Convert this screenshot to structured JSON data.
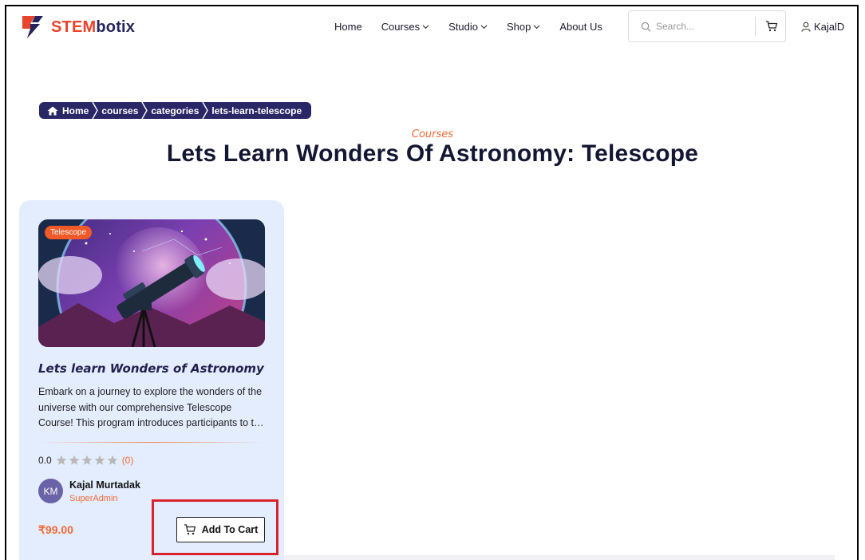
{
  "brand": {
    "name_part1": "STEM",
    "name_part2": "botix",
    "accent_color": "#e8432b",
    "dark_color": "#26245f"
  },
  "nav": {
    "items": [
      {
        "label": "Home",
        "has_dropdown": false
      },
      {
        "label": "Courses",
        "has_dropdown": true
      },
      {
        "label": "Studio",
        "has_dropdown": true
      },
      {
        "label": "Shop",
        "has_dropdown": true
      },
      {
        "label": "About Us",
        "has_dropdown": false
      }
    ]
  },
  "search": {
    "placeholder": "Search...",
    "value": ""
  },
  "user": {
    "name": "KajalD"
  },
  "breadcrumb": [
    "Home",
    "courses",
    "categories",
    "lets-learn-telescope"
  ],
  "page": {
    "eyebrow": "Courses",
    "title": "Lets Learn Wonders Of Astronomy: Telescope"
  },
  "course_card": {
    "tag": "Telescope",
    "title": "Lets learn Wonders of Astronomy",
    "description": "Embark on a journey to explore the wonders of the universe with our comprehensive Telescope Course! This program introduces participants to the fascinating world of astronomy.",
    "rating_value": "0.0",
    "rating_stars": 0,
    "rating_count": "(0)",
    "author_initials": "KM",
    "author_name": "Kajal Murtadak",
    "author_role": "SuperAdmin",
    "price": "₹99.00",
    "cta_label": "Add To Cart"
  },
  "colors": {
    "primary_orange": "#f26a36",
    "navy": "#2a2767",
    "card_bg": "#e3edfd",
    "highlight_red": "#d9232d"
  }
}
